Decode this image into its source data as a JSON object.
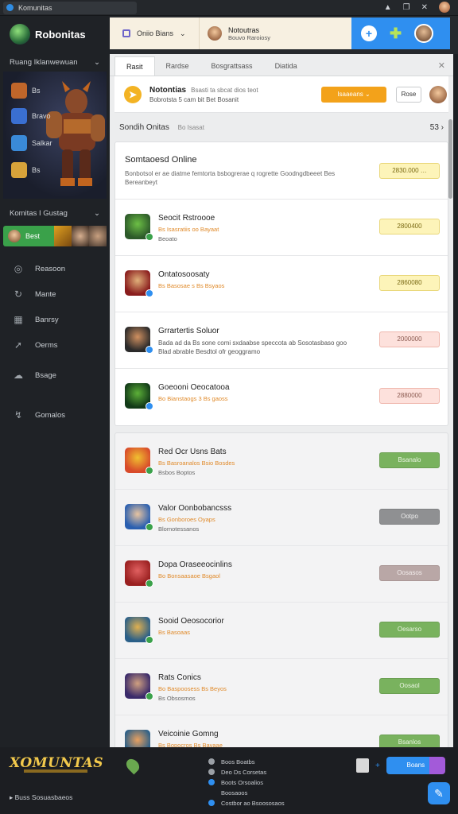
{
  "titlebar": {
    "tab_title": "Komunitas"
  },
  "sidebar": {
    "brand": "Robonitas",
    "section1_title": "Ruang Iklanwewuan",
    "hero_items": [
      {
        "label": "Bs",
        "color": "#c0662a"
      },
      {
        "label": "Bravo",
        "color": "#3a6fd1"
      },
      {
        "label": "Salkar",
        "color": "#3a8ad8"
      },
      {
        "label": "Bs",
        "color": "#d8a33a"
      }
    ],
    "section2_title": "Komitas I Gustag",
    "friend_chip": "Best",
    "nav": [
      {
        "label": "Reasoon",
        "icon": "globe-icon"
      },
      {
        "label": "Mante",
        "icon": "refresh-icon"
      },
      {
        "label": "Banrsy",
        "icon": "grid-icon"
      },
      {
        "label": "Oerms",
        "icon": "arrow-icon"
      },
      {
        "label": "Bsage",
        "icon": "cloud-icon"
      },
      {
        "label": "Gomalos",
        "icon": "route-icon"
      }
    ]
  },
  "topbar": {
    "status_label": "Oniio Bians",
    "user_name": "Notoutras",
    "user_sub": "Bouvo Raroiosy"
  },
  "main": {
    "tabs": [
      "Rasit",
      "Rardse",
      "Bosgrattsass",
      "Diatida"
    ],
    "notification": {
      "title": "Notontias",
      "title_extra": "Bsasti ta sbcat dios teot",
      "subtitle": "Bobrotsta 5 cam bit Bet Bosanit",
      "button_primary": "Isaaeans",
      "button_secondary": "Rose"
    },
    "section_title": "Sondih Onitas",
    "section_sub": "Bo Isasat",
    "section_count": "53",
    "featured": {
      "title": "Somtaoesd Online",
      "desc": "Bonbotsol er ae diatme femtorta bsbogrerae q rogrette Goodngdbeeet Bes Bereanbeyt",
      "button": "2830.000"
    },
    "rows": [
      {
        "title": "Seocit Rstroooe",
        "meta": "Bs Isasratiis oo Bayaat",
        "meta2": "Beoato",
        "button": "2800400",
        "style": "yellow",
        "icon_colors": [
          "#2d5a2a",
          "#6cbf45"
        ],
        "badge": "#3aa14a"
      },
      {
        "title": "Ontatosoosaty",
        "meta": "Bs Basosae s Bs Bsyaos",
        "meta2": "",
        "button": "2860080",
        "style": "yellow",
        "icon_colors": [
          "#8a1d1d",
          "#e0b07a"
        ],
        "badge": "#2f8ff0"
      },
      {
        "title": "Grrartertis Soluor",
        "meta": "",
        "meta2": "",
        "desc": "Bada ad da Bs sone comi sxdaabse speccota ab Sosotasbaso goo Blad abrable Besdtol ofr geoggramo",
        "button": "2000000",
        "style": "pink",
        "icon_colors": [
          "#2a2a2a",
          "#d09060"
        ],
        "badge": "#2f8ff0"
      },
      {
        "title": "Goeooni Oeocatooa",
        "meta": "Bo Bianstaogs 3 Bs gaoss",
        "meta2": "",
        "button": "2880000",
        "style": "pink",
        "icon_colors": [
          "#123a18",
          "#5cb038"
        ],
        "badge": "#2f8ff0"
      }
    ],
    "rows2": [
      {
        "title": "Red Ocr Usns Bats",
        "meta": "Bs Basroanalos Bsio Bosdes",
        "meta2": "Bsbos Boptos",
        "button": "Bsanalo",
        "style": "green",
        "icon_colors": [
          "#d84a2a",
          "#f0c030"
        ],
        "badge": "#3aa14a"
      },
      {
        "title": "Valor Oonbobancsss",
        "meta": "Bs Gonboroes Oyaps",
        "meta2": "Blomotessanos",
        "button": "Ootpo",
        "style": "gray",
        "icon_colors": [
          "#2a5fb0",
          "#e8c4a0"
        ],
        "badge": "#3aa14a"
      },
      {
        "title": "Dopa Oraseeocinlins",
        "meta": "Bo Bonsaasaoe Bsgaol",
        "meta2": "",
        "button": "Oosasos",
        "style": "mauve",
        "icon_colors": [
          "#9a2020",
          "#e06060"
        ],
        "badge": "#3aa14a"
      },
      {
        "title": "Sooid Oeosocorior",
        "meta": "Bs Basoaas",
        "meta2": "",
        "button": "Oesarso",
        "style": "green",
        "icon_colors": [
          "#2a5f88",
          "#e0b050"
        ],
        "badge": "#3aa14a"
      },
      {
        "title": "Rats Conics",
        "meta": "Bo Baspoosess Bs Beyos",
        "meta2": "Bs Obsosmos",
        "button": "Oosaol",
        "style": "green",
        "icon_colors": [
          "#3a2a6a",
          "#d0a080"
        ],
        "badge": "#3aa14a"
      },
      {
        "title": "Veicoinie Gomng",
        "meta": "Bs Bopocros Bs Bayaae",
        "meta2": "",
        "button": "Bsanlos",
        "style": "green",
        "icon_colors": [
          "#2a5f88",
          "#e8a060"
        ],
        "badge": "#3aa14a"
      }
    ]
  },
  "bottombar": {
    "logo": "XOMUNTAS",
    "footer_text": "Buss Sosuasbaeos",
    "links": [
      "Boos Boatbs",
      "Deo Ds Corsetas",
      "Boots Orsoalios",
      "Boosaoos",
      "Costbor ao Bsoososaos"
    ],
    "action_label": "Boans"
  }
}
